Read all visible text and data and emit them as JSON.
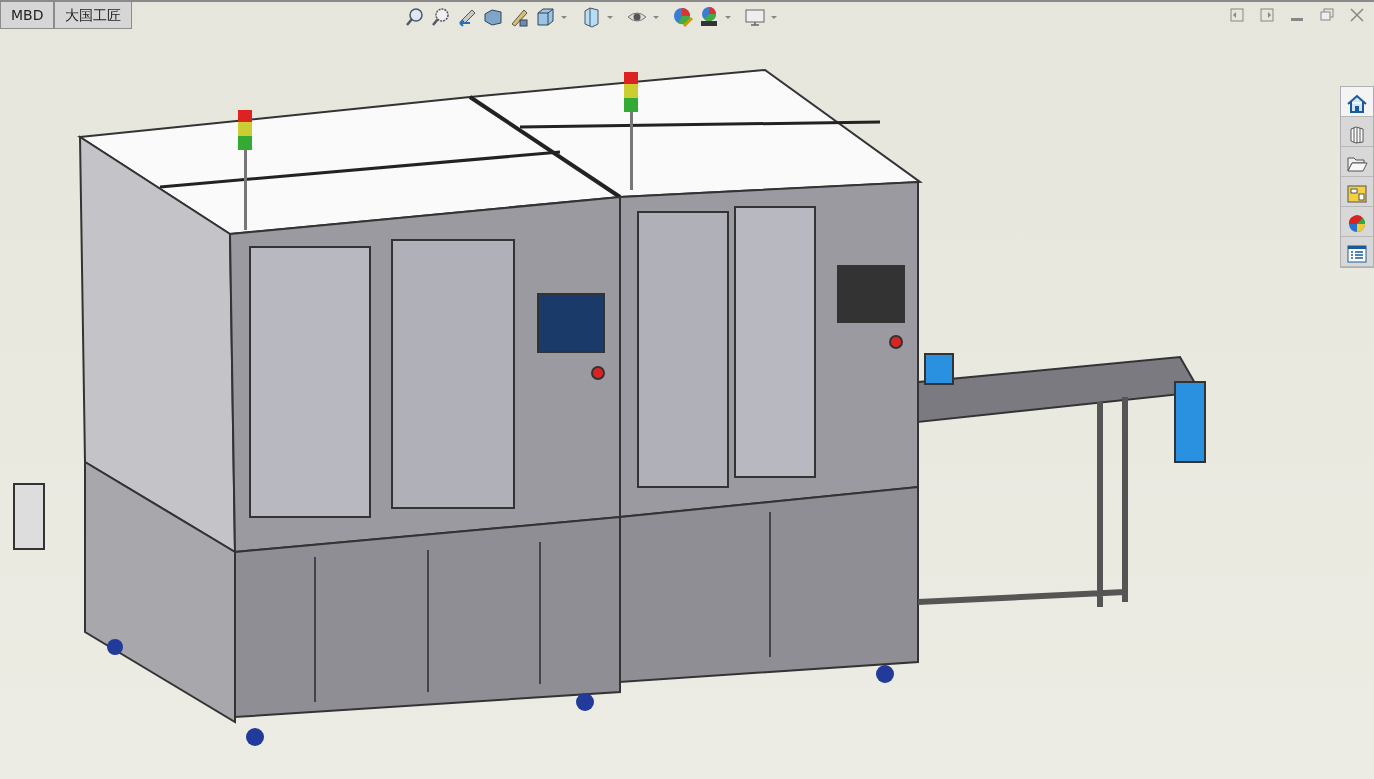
{
  "tabs": [
    {
      "label": "MBD"
    },
    {
      "label": "大国工匠"
    }
  ]
}
